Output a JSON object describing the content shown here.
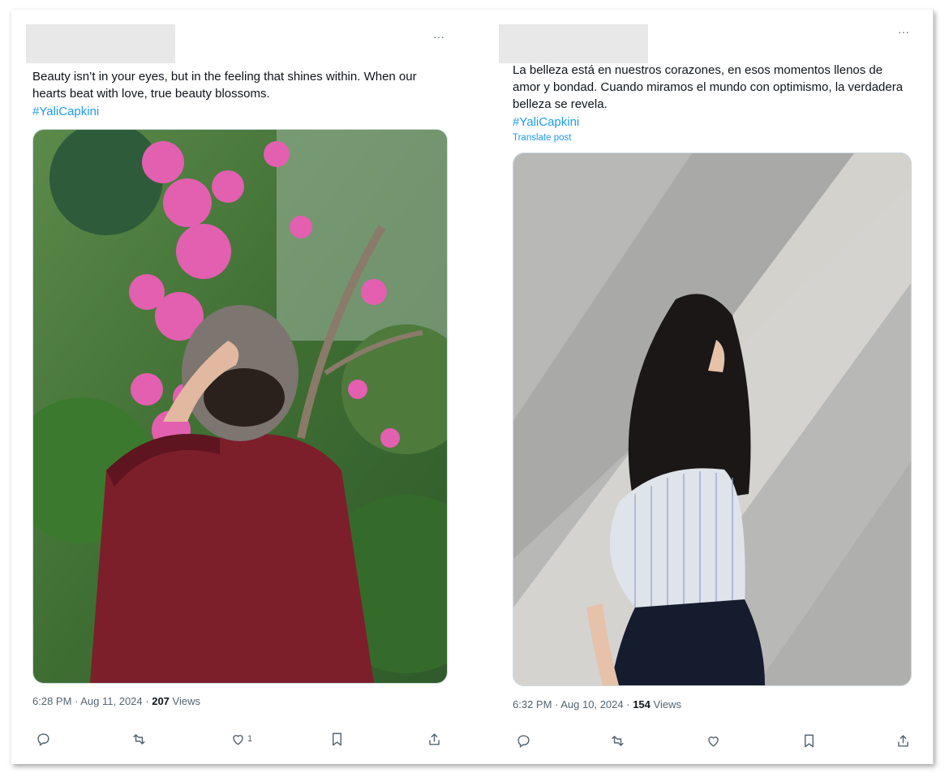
{
  "posts": [
    {
      "text_lines": [
        "Beauty isn’t in your eyes, but in the feeling that shines within. When our",
        "hearts beat with love, true beauty blossoms."
      ],
      "hashtag": "#YaliCapkini",
      "translate": "",
      "time": "6:28 PM",
      "date": "Aug 11, 2024",
      "views_count": "207",
      "views_label": "Views",
      "like_count": "1",
      "photo_description_icon": "image-woman-flowers"
    },
    {
      "text_lines": [
        "La belleza está en nuestros corazones, en esos momentos llenos de",
        "amor y bondad. Cuando miramos el mundo con optimismo, la verdadera",
        "belleza se revela."
      ],
      "hashtag": "#YaliCapkini",
      "translate": "Translate post",
      "time": "6:32 PM",
      "date": "Aug 10, 2024",
      "views_count": "154",
      "views_label": "Views",
      "like_count": "",
      "photo_description_icon": "image-woman-wall"
    }
  ],
  "more_glyph": "···",
  "separator": " · ",
  "icons": [
    "reply-icon",
    "retweet-icon",
    "like-icon",
    "bookmark-icon",
    "share-icon"
  ],
  "colors": {
    "link": "#1d9bf0",
    "muted": "#536471",
    "text": "#0f1419"
  }
}
